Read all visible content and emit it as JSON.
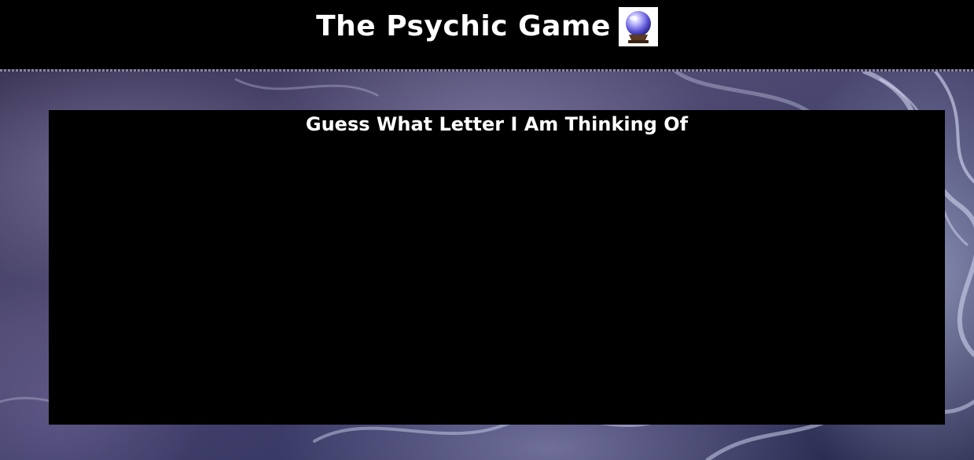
{
  "header": {
    "title": "The Psychic Game",
    "icon": "crystal-ball-icon"
  },
  "panel": {
    "heading": "Guess What Letter I Am Thinking Of"
  },
  "colors": {
    "header_bg": "#000000",
    "panel_bg": "#000000",
    "text": "#ffffff",
    "background_tone": "#4f4a72"
  }
}
